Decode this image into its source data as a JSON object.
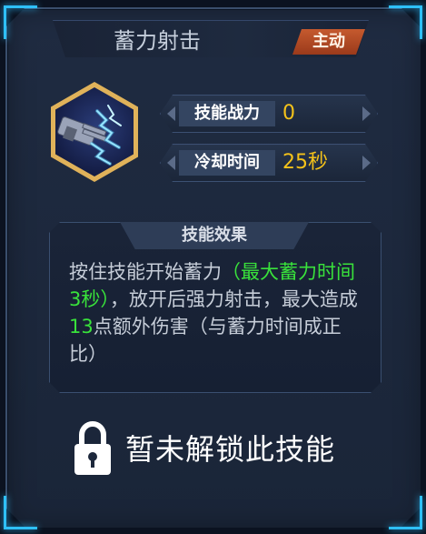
{
  "title": "蓄力射击",
  "badge": "主动",
  "skill_icon": "gatling-gun-lightning-icon",
  "stats": [
    {
      "label": "技能战力",
      "value": "0"
    },
    {
      "label": "冷却时间",
      "value": "25秒"
    }
  ],
  "effect": {
    "header": "技能效果",
    "part1": "按住技能开始蓄力",
    "part2_green": "（最大蓄力时间3秒）",
    "part3": "，放开后强力射击，最大造成",
    "part4_green": "13",
    "part5": "点额外伤害（与蓄力时间成正比）"
  },
  "lock": {
    "icon": "padlock-icon",
    "text": "暂未解锁此技能"
  },
  "colors": {
    "accent_blue": "#2ec0ff",
    "badge_orange": "#c55a2e",
    "value_yellow": "#f4c21a",
    "highlight_green": "#39e23b"
  }
}
